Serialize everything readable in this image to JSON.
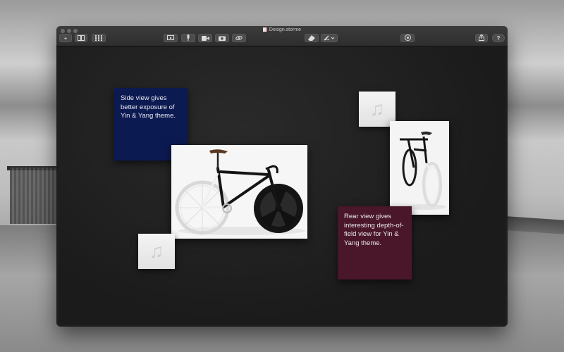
{
  "window": {
    "title": "Design.storme"
  },
  "toolbar": {
    "add_label": "+",
    "help_label": "?"
  },
  "cards": {
    "note_side": {
      "text": "Side view gives better exposure of Yin & Yang theme.",
      "color": "#0c1a52"
    },
    "note_rear": {
      "text": "Rear view gives interesting depth-of-field view for Yin & Yang theme.",
      "color": "#4a1629"
    },
    "audio_glyph": "♫"
  },
  "icons": [
    "add-icon",
    "book-icon",
    "grid-icon",
    "screen-icon",
    "microphone-icon",
    "video-icon",
    "camera-icon",
    "link-icon",
    "eraser-icon",
    "pen-icon",
    "palette-icon",
    "share-icon",
    "help-icon",
    "music-note-icon"
  ]
}
